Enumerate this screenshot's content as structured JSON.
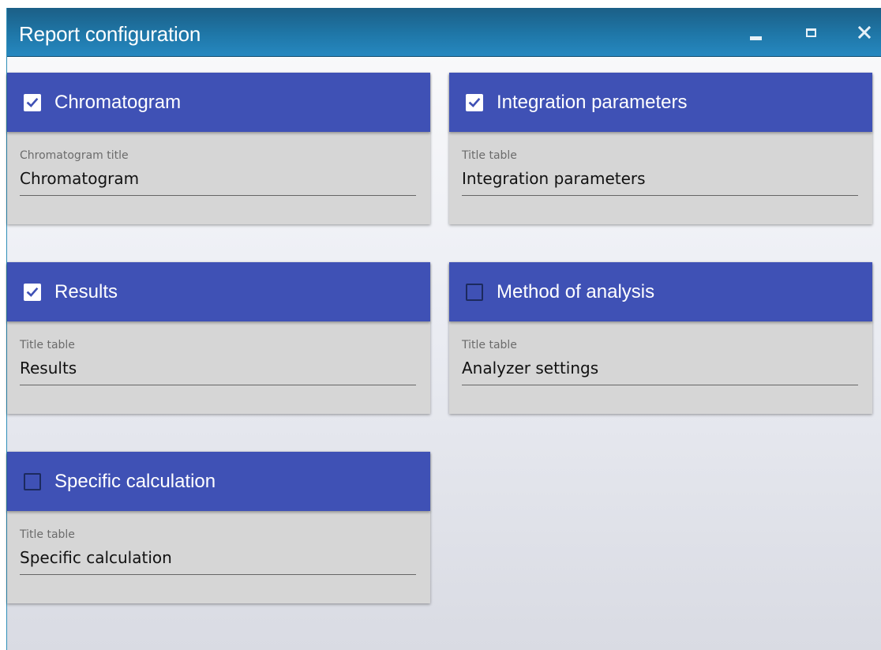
{
  "window": {
    "title": "Report configuration",
    "controls": [
      "minimize",
      "maximize",
      "close"
    ]
  },
  "colors": {
    "titlebar": "#1f77a8",
    "card_header": "#3f51b5",
    "card_body": "#d6d6d6"
  },
  "sections": [
    {
      "title": "Chromatogram",
      "checked": true,
      "field_label": "Chromatogram title",
      "field_value": "Chromatogram"
    },
    {
      "title": "Integration parameters",
      "checked": true,
      "field_label": "Title table",
      "field_value": "Integration parameters"
    },
    {
      "title": "Results",
      "checked": true,
      "field_label": "Title table",
      "field_value": "Results"
    },
    {
      "title": "Method of analysis",
      "checked": false,
      "field_label": "Title table",
      "field_value": "Analyzer settings"
    },
    {
      "title": "Specific calculation",
      "checked": false,
      "field_label": "Title table",
      "field_value": "Specific calculation"
    }
  ]
}
